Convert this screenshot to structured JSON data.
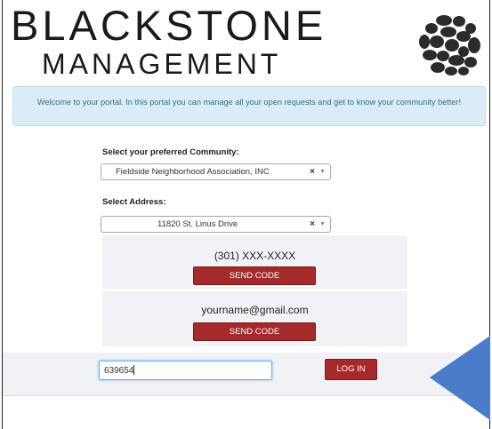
{
  "brand": {
    "line1": "BLACKSTONE",
    "line2": "MANAGEMENT"
  },
  "welcome": {
    "text": "Welcome to your portal. In this portal you can manage all your open requests and get to know your community better!"
  },
  "community": {
    "label": "Select your preferred Community:",
    "selected": "Fieldside Neighborhood Association, INC",
    "clear": "×",
    "arrow": "▼"
  },
  "address": {
    "label": "Select Address:",
    "selected": "11820 St. Linus Drive",
    "clear": "×",
    "arrow": "▼"
  },
  "phone_panel": {
    "phone": "(301) XXX-XXXX",
    "button": "SEND CODE"
  },
  "email_panel": {
    "email": "yourname@gmail.com",
    "button": "SEND CODE"
  },
  "login": {
    "code_value": "639654",
    "button": "LOG IN"
  },
  "colors": {
    "accent_red": "#a52a2a",
    "info_bg": "#d9ecf7",
    "info_text": "#31708f",
    "panel_bg": "#f0f2f5",
    "pointer": "#4a7cc9"
  },
  "icons": {
    "logo": "stones-logo-icon",
    "pointer": "arrow-pointer-icon"
  }
}
